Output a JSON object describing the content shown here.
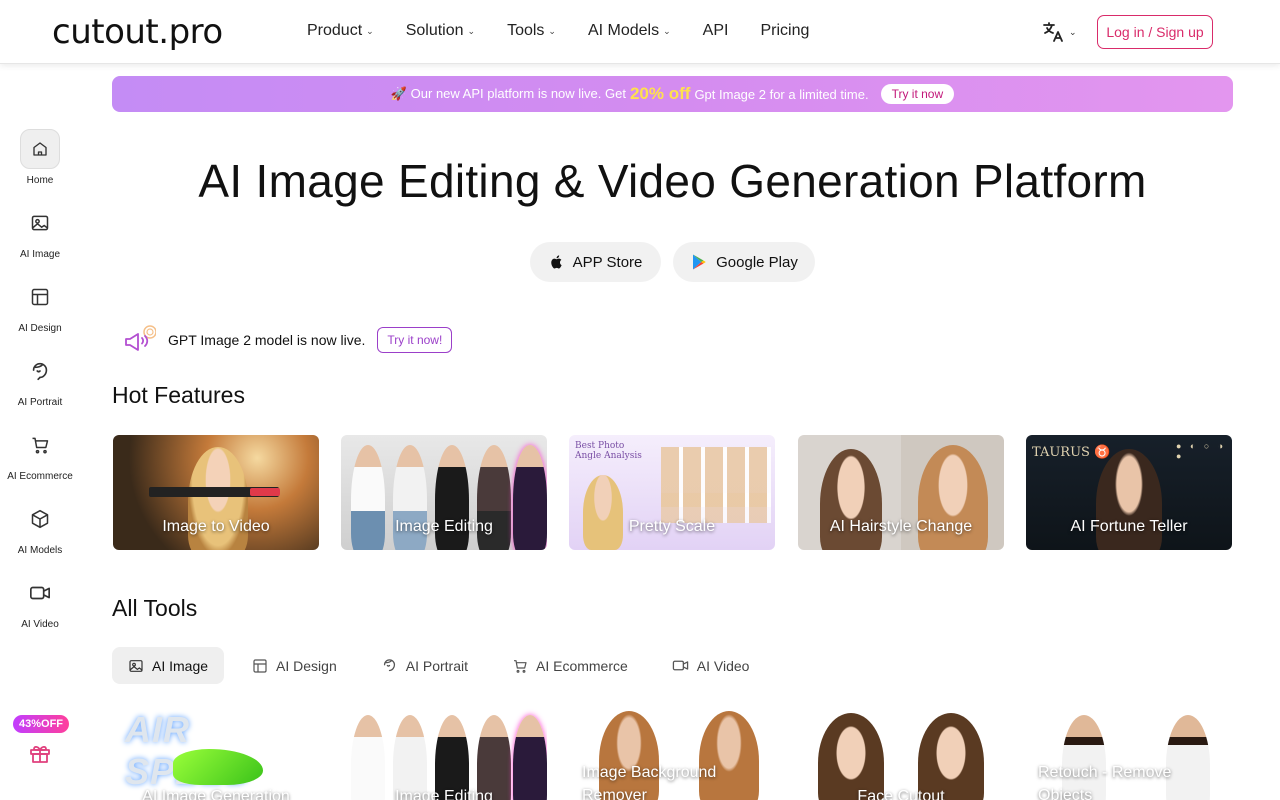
{
  "header": {
    "logo": "cutout.pro",
    "nav": [
      {
        "label": "Product",
        "dropdown": true
      },
      {
        "label": "Solution",
        "dropdown": true
      },
      {
        "label": "Tools",
        "dropdown": true
      },
      {
        "label": "AI Models",
        "dropdown": true
      },
      {
        "label": "API",
        "dropdown": false
      },
      {
        "label": "Pricing",
        "dropdown": false
      }
    ],
    "language_icon": "translate-icon",
    "login_label": "Log in / Sign up"
  },
  "sidebar": {
    "items": [
      {
        "label": "Home",
        "icon": "home-icon"
      },
      {
        "label": "AI Image",
        "icon": "image-icon"
      },
      {
        "label": "AI Design",
        "icon": "layout-icon"
      },
      {
        "label": "AI Portrait",
        "icon": "portrait-icon"
      },
      {
        "label": "AI Ecommerce",
        "icon": "cart-icon"
      },
      {
        "label": "AI Models",
        "icon": "cube-icon"
      },
      {
        "label": "AI Video",
        "icon": "video-icon"
      }
    ],
    "promo_badge": "43%OFF",
    "gift_icon": "gift-icon"
  },
  "banner": {
    "text_before": "🚀 Our new API platform is now live. Get",
    "highlight": "20% off",
    "text_after": "Gpt Image 2 for a limited time.",
    "try_label": "Try it now"
  },
  "hero": {
    "title": "AI Image Editing & Video Generation Platform",
    "app_store": "APP Store",
    "google_play": "Google Play"
  },
  "announcement": {
    "text": "GPT Image 2 model is now live.",
    "try_label": "Try it now!"
  },
  "hot_features": {
    "title": "Hot Features",
    "cards": [
      {
        "label": "Image to Video"
      },
      {
        "label": "Image Editing"
      },
      {
        "label": "Pretty Scale"
      },
      {
        "label": "AI Hairstyle Change"
      },
      {
        "label": "AI Fortune Teller"
      }
    ]
  },
  "all_tools": {
    "title": "All Tools",
    "tabs": [
      {
        "label": "AI Image",
        "icon": "image-icon",
        "active": true
      },
      {
        "label": "AI Design",
        "icon": "layout-icon",
        "active": false
      },
      {
        "label": "AI Portrait",
        "icon": "portrait-icon",
        "active": false
      },
      {
        "label": "AI Ecommerce",
        "icon": "cart-icon",
        "active": false
      },
      {
        "label": "AI Video",
        "icon": "video-icon",
        "active": false
      }
    ],
    "cards": [
      {
        "label": "AI Image Generation"
      },
      {
        "label": "Image Editing"
      },
      {
        "label": "Image Background Remover"
      },
      {
        "label": "Face Cutout"
      },
      {
        "label": "Retouch - Remove Objects"
      }
    ]
  },
  "colors": {
    "accent": "#d92b6a",
    "banner_start": "#c48cf5",
    "banner_end": "#e396ef",
    "highlight": "#ffe14d"
  }
}
